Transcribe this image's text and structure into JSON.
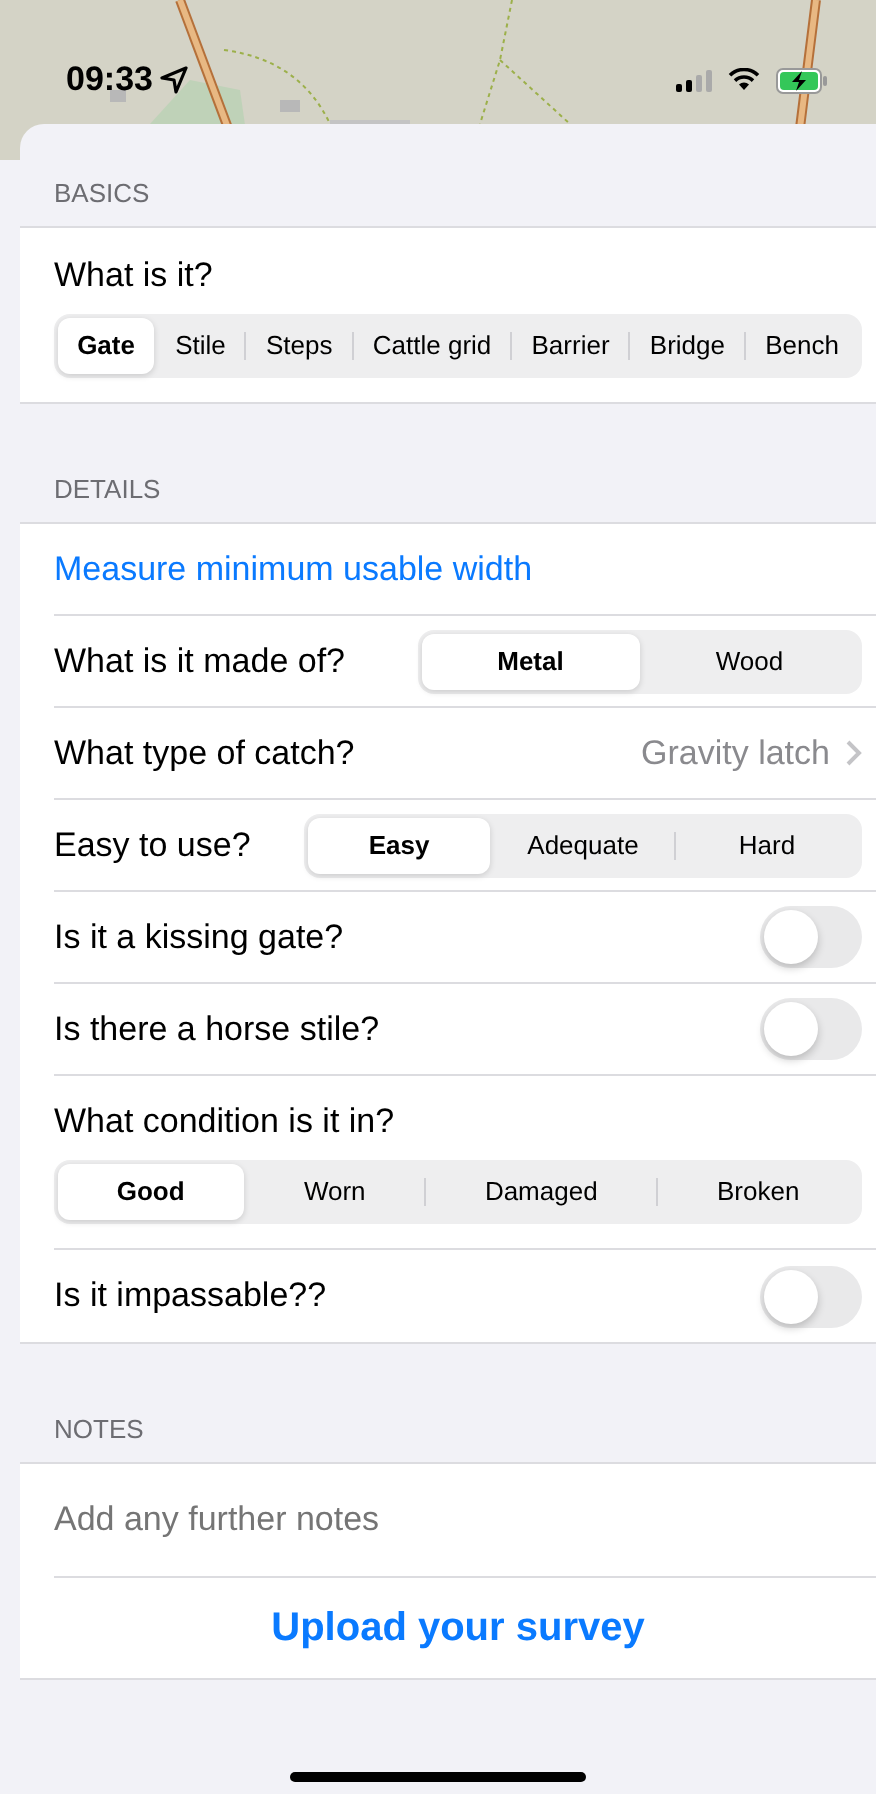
{
  "status_bar": {
    "time": "09:33"
  },
  "sections": [
    {
      "header": "BASICS",
      "rows": [
        {
          "kind": "segmented-block",
          "label": "What is it?",
          "options": [
            {
              "label": "Gate",
              "selected": true
            },
            {
              "label": "Stile",
              "selected": false
            },
            {
              "label": "Steps",
              "selected": false
            },
            {
              "label": "Cattle grid",
              "selected": false
            },
            {
              "label": "Barrier",
              "selected": false
            },
            {
              "label": "Bridge",
              "selected": false
            },
            {
              "label": "Bench",
              "selected": false
            }
          ]
        }
      ]
    },
    {
      "header": "DETAILS",
      "rows": [
        {
          "kind": "link",
          "label": "Measure minimum usable width"
        },
        {
          "kind": "segmented",
          "label": "What is it made of?",
          "options": [
            {
              "label": "Metal",
              "selected": true
            },
            {
              "label": "Wood",
              "selected": false
            }
          ]
        },
        {
          "kind": "disclosure",
          "label": "What type of catch?",
          "value": "Gravity latch"
        },
        {
          "kind": "segmented",
          "label": "Easy to use?",
          "options": [
            {
              "label": "Easy",
              "selected": true
            },
            {
              "label": "Adequate",
              "selected": false
            },
            {
              "label": "Hard",
              "selected": false
            }
          ]
        },
        {
          "kind": "toggle",
          "label": "Is it a kissing gate?",
          "on": false
        },
        {
          "kind": "toggle",
          "label": "Is there a horse stile?",
          "on": false
        },
        {
          "kind": "segmented-block",
          "label": "What condition is it in?",
          "options": [
            {
              "label": "Good",
              "selected": true
            },
            {
              "label": "Worn",
              "selected": false
            },
            {
              "label": "Damaged",
              "selected": false
            },
            {
              "label": "Broken",
              "selected": false
            }
          ]
        },
        {
          "kind": "toggle",
          "label": "Is it impassable??",
          "on": false
        }
      ]
    },
    {
      "header": "NOTES",
      "rows": [
        {
          "kind": "note-field",
          "placeholder": "Add any further notes"
        },
        {
          "kind": "action",
          "label": "Upload your survey"
        }
      ]
    }
  ]
}
